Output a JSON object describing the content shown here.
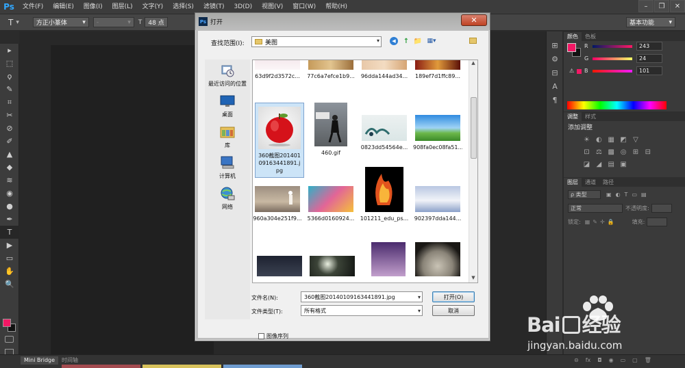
{
  "app": {
    "logo": "Ps"
  },
  "menubar": {
    "items": [
      "文件(F)",
      "编辑(E)",
      "图像(I)",
      "图层(L)",
      "文字(Y)",
      "选择(S)",
      "滤镜(T)",
      "3D(D)",
      "视图(V)",
      "窗口(W)",
      "帮助(H)"
    ]
  },
  "window_controls": {
    "minimize": "–",
    "restore": "❐",
    "close": "✕"
  },
  "options": {
    "tool_glyph": "T",
    "font_family": "方正小篆体",
    "font_style": "-",
    "font_size": "48 点",
    "workspace": "基本功能"
  },
  "tools": [
    "▸",
    "⬚",
    "ϙ",
    "✎",
    "⌗",
    "✂",
    "⊘",
    "✐",
    "▲",
    "◆",
    "≋",
    "◉",
    "●",
    "✒",
    "T",
    "▶",
    "▭",
    "✋",
    "🔍"
  ],
  "colors": {
    "foreground": "#f31865",
    "background": "#111111",
    "accent": "#31a8ff"
  },
  "dock_icons": [
    "⊞",
    "⚙",
    "⊟",
    "A",
    "¶"
  ],
  "color_panel": {
    "tabs": [
      "颜色",
      "色板"
    ],
    "channels": [
      {
        "label": "R",
        "value": "243"
      },
      {
        "label": "G",
        "value": "24"
      },
      {
        "label": "B",
        "value": "101"
      }
    ]
  },
  "adjust_panel": {
    "tabs": [
      "调整",
      "样式"
    ],
    "title": "添加调整",
    "row1": [
      "☀",
      "◐",
      "▦",
      "◩",
      "▽"
    ],
    "row2": [
      "⊡",
      "⚖",
      "▩",
      "◎",
      "⊞",
      "⊟"
    ],
    "row3": [
      "◪",
      "◢",
      "▤",
      "▣"
    ]
  },
  "layers_panel": {
    "tabs": [
      "图层",
      "通道",
      "路径"
    ],
    "filter_label": "ρ 类型",
    "blend": "正常",
    "opacity_label": "不透明度:",
    "lock_label": "锁定:",
    "fill_label": "填充:"
  },
  "bottom": {
    "tabs": [
      "Mini Bridge",
      "时间轴"
    ],
    "icons": [
      "⊝",
      "fx",
      "◘",
      "◉",
      "▭",
      "▢",
      "🗑"
    ]
  },
  "dialog": {
    "title": "打开",
    "close_glyph": "✕",
    "lookin_label": "查找范围(I):",
    "lookin_value": "美图",
    "nav_icons": [
      "◀",
      "↑",
      "📁",
      "▦▾"
    ],
    "places": [
      {
        "label": "最近访问的位置"
      },
      {
        "label": "桌面"
      },
      {
        "label": "库"
      },
      {
        "label": "计算机"
      },
      {
        "label": "网络"
      }
    ],
    "files_row0": [
      "63d9f2d3572c...",
      "77c6a7efce1b9...",
      "96dda144ad34...",
      "189ef7d1ffc89..."
    ],
    "files_row1": [
      "360截图20140109163441891.jpg",
      "460.gif",
      "0823dd54564e...",
      "908fa0ec08fa51..."
    ],
    "files_row2": [
      "960a304e251f9...",
      "5366d0160924...",
      "101211_edu_ps...",
      "902397dda144..."
    ],
    "file_name_label": "文件名(N):",
    "file_name_value": "360截图20140109163441891.jpg",
    "file_type_label": "文件类型(T):",
    "file_type_value": "所有格式",
    "open_button": "打开(O)",
    "cancel_button": "取消",
    "sequence_label": "图像序列"
  },
  "watermark": {
    "brand": "Bai",
    "brand_end": "经验",
    "url": "jingyan.baidu.com"
  }
}
